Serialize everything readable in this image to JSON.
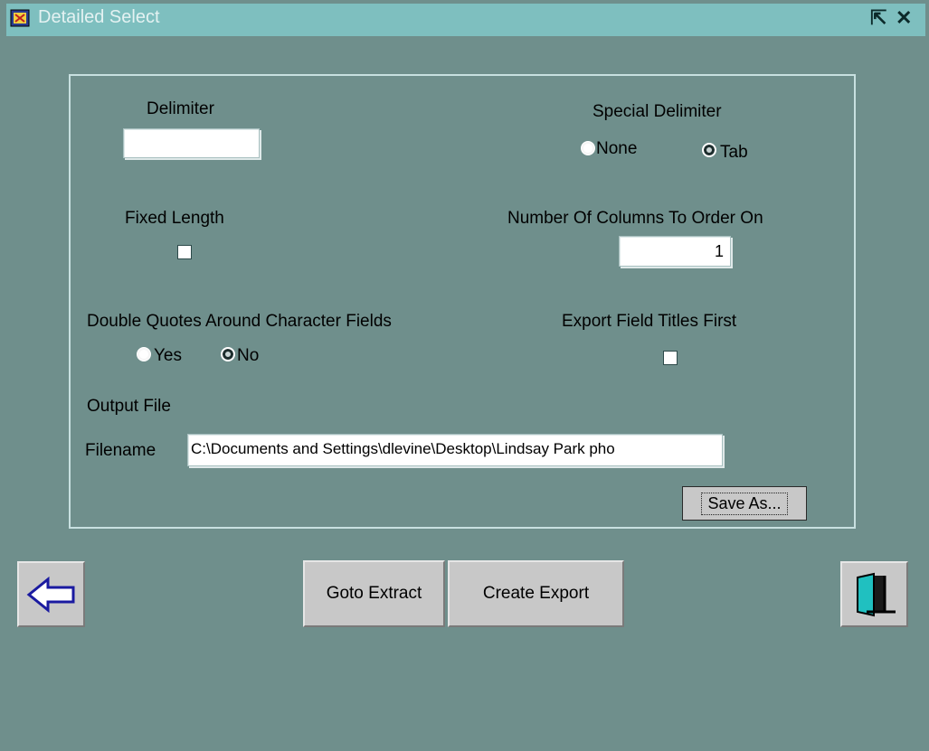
{
  "window": {
    "title": "Detailed Select"
  },
  "delimiter": {
    "label": "Delimiter",
    "value": ""
  },
  "special_delimiter": {
    "label": "Special Delimiter",
    "options": [
      {
        "label": "None",
        "selected": true
      },
      {
        "label": "Tab",
        "selected": false
      }
    ]
  },
  "fixed_length": {
    "label": "Fixed Length",
    "checked": false
  },
  "columns_to_order": {
    "label": "Number Of Columns To Order On",
    "value": "1"
  },
  "double_quotes": {
    "label": "Double Quotes  Around Character Fields",
    "options": [
      {
        "label": "Yes",
        "selected": true
      },
      {
        "label": "No",
        "selected": false
      }
    ]
  },
  "export_titles": {
    "label": "Export Field Titles First",
    "checked": false
  },
  "output": {
    "section_label": "Output File",
    "filename_label": "Filename",
    "filename_value": "C:\\Documents and Settings\\dlevine\\Desktop\\Lindsay Park pho",
    "save_as_label": "Save As..."
  },
  "footer": {
    "goto_extract_label": "Goto Extract",
    "create_export_label": "Create Export",
    "back_icon": "left-arrow-icon",
    "exit_icon": "door-exit-icon"
  },
  "colors": {
    "background": "#6f8f8c",
    "titlebar": "#7ebfbf",
    "button": "#c8c8c8"
  }
}
